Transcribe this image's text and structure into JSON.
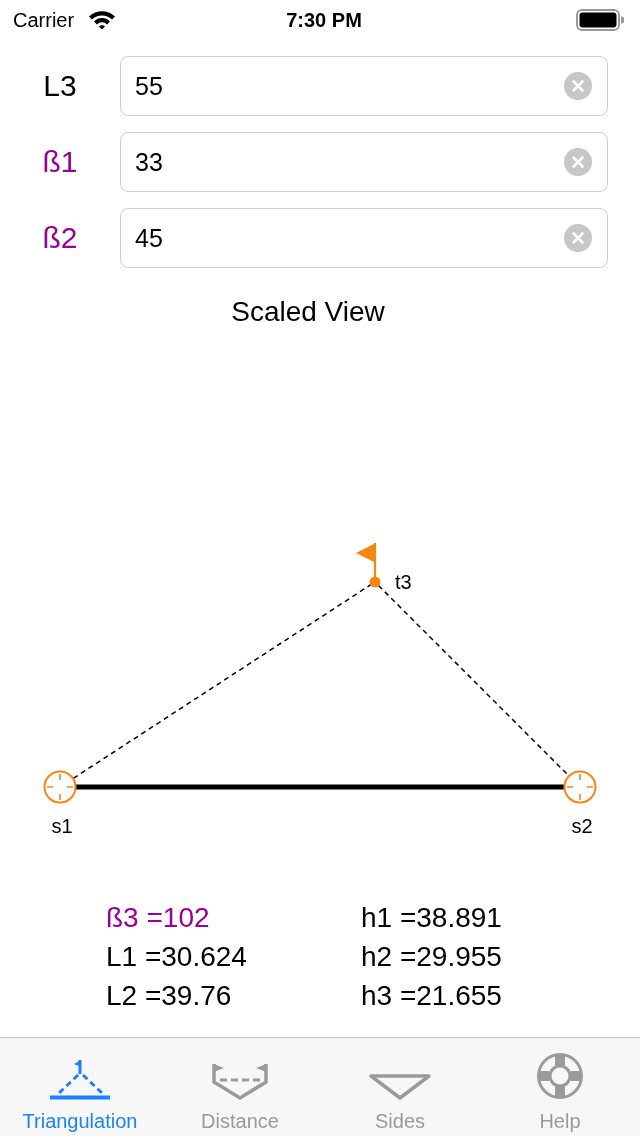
{
  "status_bar": {
    "carrier": "Carrier",
    "time": "7:30 PM"
  },
  "inputs": [
    {
      "label": "L3",
      "value": "55",
      "color": "#000000"
    },
    {
      "label": "ß1",
      "value": "33",
      "color": "#990099"
    },
    {
      "label": "ß2",
      "value": "45",
      "color": "#990099"
    }
  ],
  "view_title": "Scaled View",
  "diagram": {
    "points": [
      {
        "label": "s1",
        "kind": "station"
      },
      {
        "label": "s2",
        "kind": "station"
      },
      {
        "label": "t3",
        "kind": "target"
      }
    ]
  },
  "results": [
    {
      "text": "ß3 =102",
      "color": "#990099"
    },
    {
      "text": "h1 =38.891",
      "color": "#000000"
    },
    {
      "text": "L1 =30.624",
      "color": "#000000"
    },
    {
      "text": "h2 =29.955",
      "color": "#000000"
    },
    {
      "text": "L2 =39.76",
      "color": "#000000"
    },
    {
      "text": "h3 =21.655",
      "color": "#000000"
    }
  ],
  "tabs": [
    {
      "label": "Triangulation",
      "kind": "triangulation",
      "selected": true
    },
    {
      "label": "Distance",
      "kind": "distance",
      "selected": false
    },
    {
      "label": "Sides",
      "kind": "sides",
      "selected": false
    },
    {
      "label": "Help",
      "kind": "help",
      "selected": false
    }
  ]
}
